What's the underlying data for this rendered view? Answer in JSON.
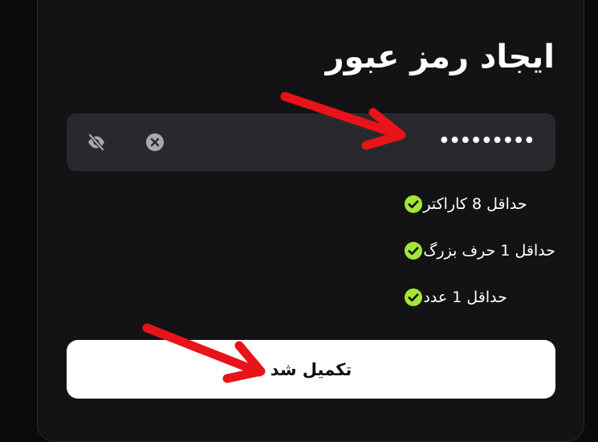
{
  "form": {
    "title": "ایجاد رمز عبور",
    "password_field": {
      "value": "•••••••••",
      "toggle_icon": "eye-off-icon",
      "clear_icon": "clear-circle-icon"
    },
    "requirements": [
      {
        "text": "حداقل 8 کاراکتر",
        "met": true
      },
      {
        "text": "حداقل 1 حرف بزرگ",
        "met": true
      },
      {
        "text": "حداقل 1 عدد",
        "met": true
      }
    ],
    "submit_label": "تکمیل شد"
  },
  "colors": {
    "background": "#0a0a0b",
    "card": "#131315",
    "field": "#29292d",
    "check": "#a3e635",
    "arrow": "#e8141a",
    "button": "#ffffff"
  }
}
